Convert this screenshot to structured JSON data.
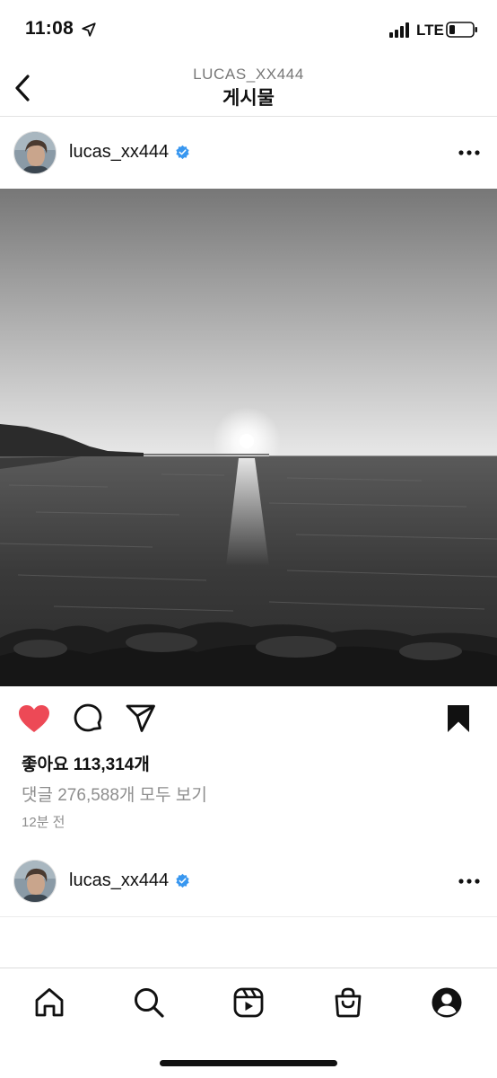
{
  "status_bar": {
    "time": "11:08",
    "network": "LTE"
  },
  "header": {
    "subtitle": "LUCAS_XX444",
    "title": "게시물"
  },
  "post": {
    "username": "lucas_xx444",
    "likes": "좋아요 113,314개",
    "comments": "댓글 276,588개 모두 보기",
    "time_ago": "12분 전",
    "liked": true
  },
  "next_post": {
    "username": "lucas_xx444"
  },
  "colors": {
    "like": "#ed4956",
    "verified": "#3897f0",
    "muted": "#8e8e8e"
  },
  "tabs": [
    "home-icon",
    "search-icon",
    "reels-icon",
    "shop-icon",
    "profile-icon"
  ]
}
